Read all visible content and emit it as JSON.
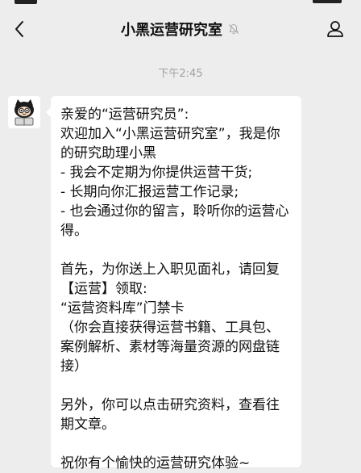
{
  "chat": {
    "title": "小黑运营研究室",
    "timestamp": "下午2:45",
    "mute_icon": "bell-muted-icon",
    "back_icon": "chevron-left-icon",
    "profile_icon": "person-icon"
  },
  "message": {
    "sender_avatar": "black-cat-avatar",
    "lines": [
      "亲爱的“运营研究员”:",
      "欢迎加入“小黑运营研究室”，我是你的研究助理小黑",
      "- 我会不定期为你提供运营干货;",
      "- 长期向你汇报运营工作记录;",
      "- 也会通过你的留言，聆听你的运营心得。",
      "",
      "首先，为你送上入职见面礼，请回复【运营】领取:",
      "“运营资料库”门禁卡",
      "（你会直接获得运营书籍、工具包、案例解析、素材等海量资源的网盘链接）",
      "",
      "另外，你可以点击研究资料，查看往期文章。",
      "",
      "祝你有个愉快的运营研究体验~"
    ]
  }
}
